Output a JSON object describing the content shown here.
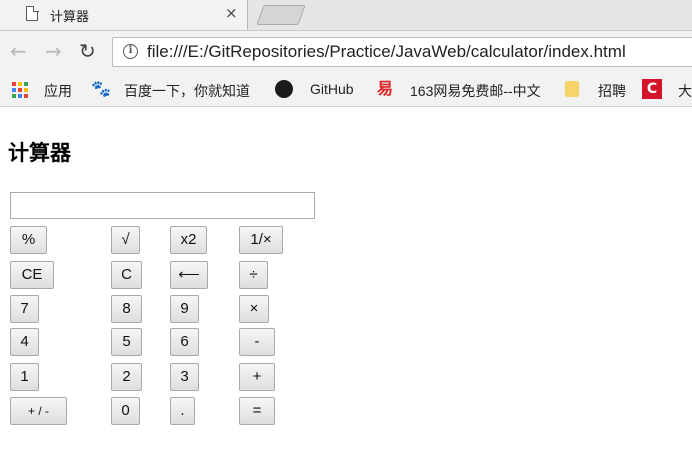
{
  "browser": {
    "tab_title": "计算器",
    "tab_close": "×",
    "nav_back": "←",
    "nav_forward": "→",
    "nav_reload": "↻",
    "info_glyph": "i",
    "url": "file:///E:/GitRepositories/Practice/JavaWeb/calculator/index.html"
  },
  "bookmarks": [
    {
      "label": "应用",
      "icon": "apps-icon"
    },
    {
      "label": "百度一下，你就知道",
      "icon": "baidu-paw-icon"
    },
    {
      "label": "GitHub",
      "icon": "github-icon"
    },
    {
      "label": "163网易免费邮--中文",
      "icon": "netease-icon"
    },
    {
      "label": "招聘",
      "icon": "folder-icon"
    },
    {
      "label": "大",
      "icon": "c-logo-icon"
    }
  ],
  "bookmark_glyphs": {
    "baidu": "🐾",
    "netease": "易",
    "c_logo": "C"
  },
  "page": {
    "title": "计算器",
    "display_value": ""
  },
  "calculator": {
    "rows": [
      [
        "%",
        "√",
        "x2",
        "1/×"
      ],
      [
        "CE",
        "C",
        "⟵",
        "÷"
      ],
      [
        "7",
        "8",
        "9",
        "×"
      ],
      [
        "4",
        "5",
        "6",
        "-"
      ],
      [
        "1",
        "2",
        "3",
        "+"
      ],
      [
        "+ / -",
        "0",
        ".",
        "="
      ]
    ]
  }
}
